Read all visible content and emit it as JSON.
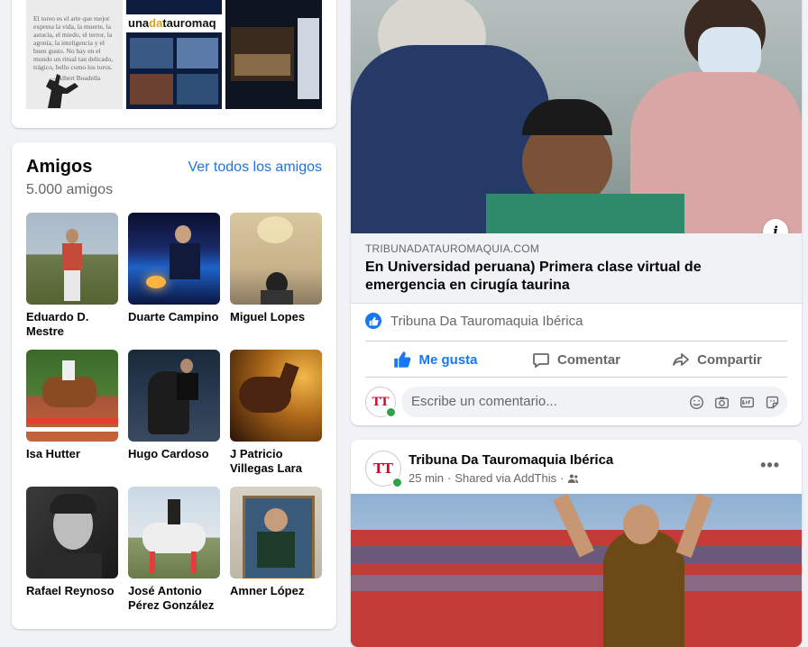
{
  "photos_card": {
    "quote_lines": [
      "El toreo es el arte que mejor expresa la vida, la muerte, la astucia, el miedo, el terror, la agonía, la inteligencia y el buen gusto. No hay en el mundo un ritual tan delicado, trágico, bello como los toros.",
      "— Albert Boadella"
    ],
    "logo_part1": "una",
    "logo_part2": "da",
    "logo_part3": "tauromaq"
  },
  "friends": {
    "title": "Amigos",
    "count": "5.000 amigos",
    "see_all": "Ver todos los amigos",
    "items": [
      {
        "name": "Eduardo D. Mestre"
      },
      {
        "name": "Duarte Campino"
      },
      {
        "name": "Miguel Lopes"
      },
      {
        "name": "Isa Hutter"
      },
      {
        "name": "Hugo Cardoso"
      },
      {
        "name": "J Patricio Villegas Lara"
      },
      {
        "name": "Rafael Reynoso"
      },
      {
        "name": "José Antonio Pérez González"
      },
      {
        "name": "Amner López"
      }
    ]
  },
  "link_post": {
    "domain": "TRIBUNADATAUROMAQUIA.COM",
    "title": "En Universidad peruana) Primera clase virtual de emergencia en cirugía taurina",
    "page_name": "Tribuna Da Tauromaquia Ibérica",
    "actions": {
      "like": "Me gusta",
      "comment": "Comentar",
      "share": "Compartir"
    },
    "comment_placeholder": "Escribe un comentario...",
    "avatar_text": "TT"
  },
  "post2": {
    "author": "Tribuna Da Tauromaquia Ibérica",
    "time": "25 min",
    "shared_via": "Shared via AddThis",
    "separator": "·",
    "more": "•••",
    "avatar_text": "TT"
  },
  "colors": {
    "accent": "#1877f2",
    "link": "#1b74e4",
    "online": "#31a24c",
    "background": "#f0f2f5"
  }
}
